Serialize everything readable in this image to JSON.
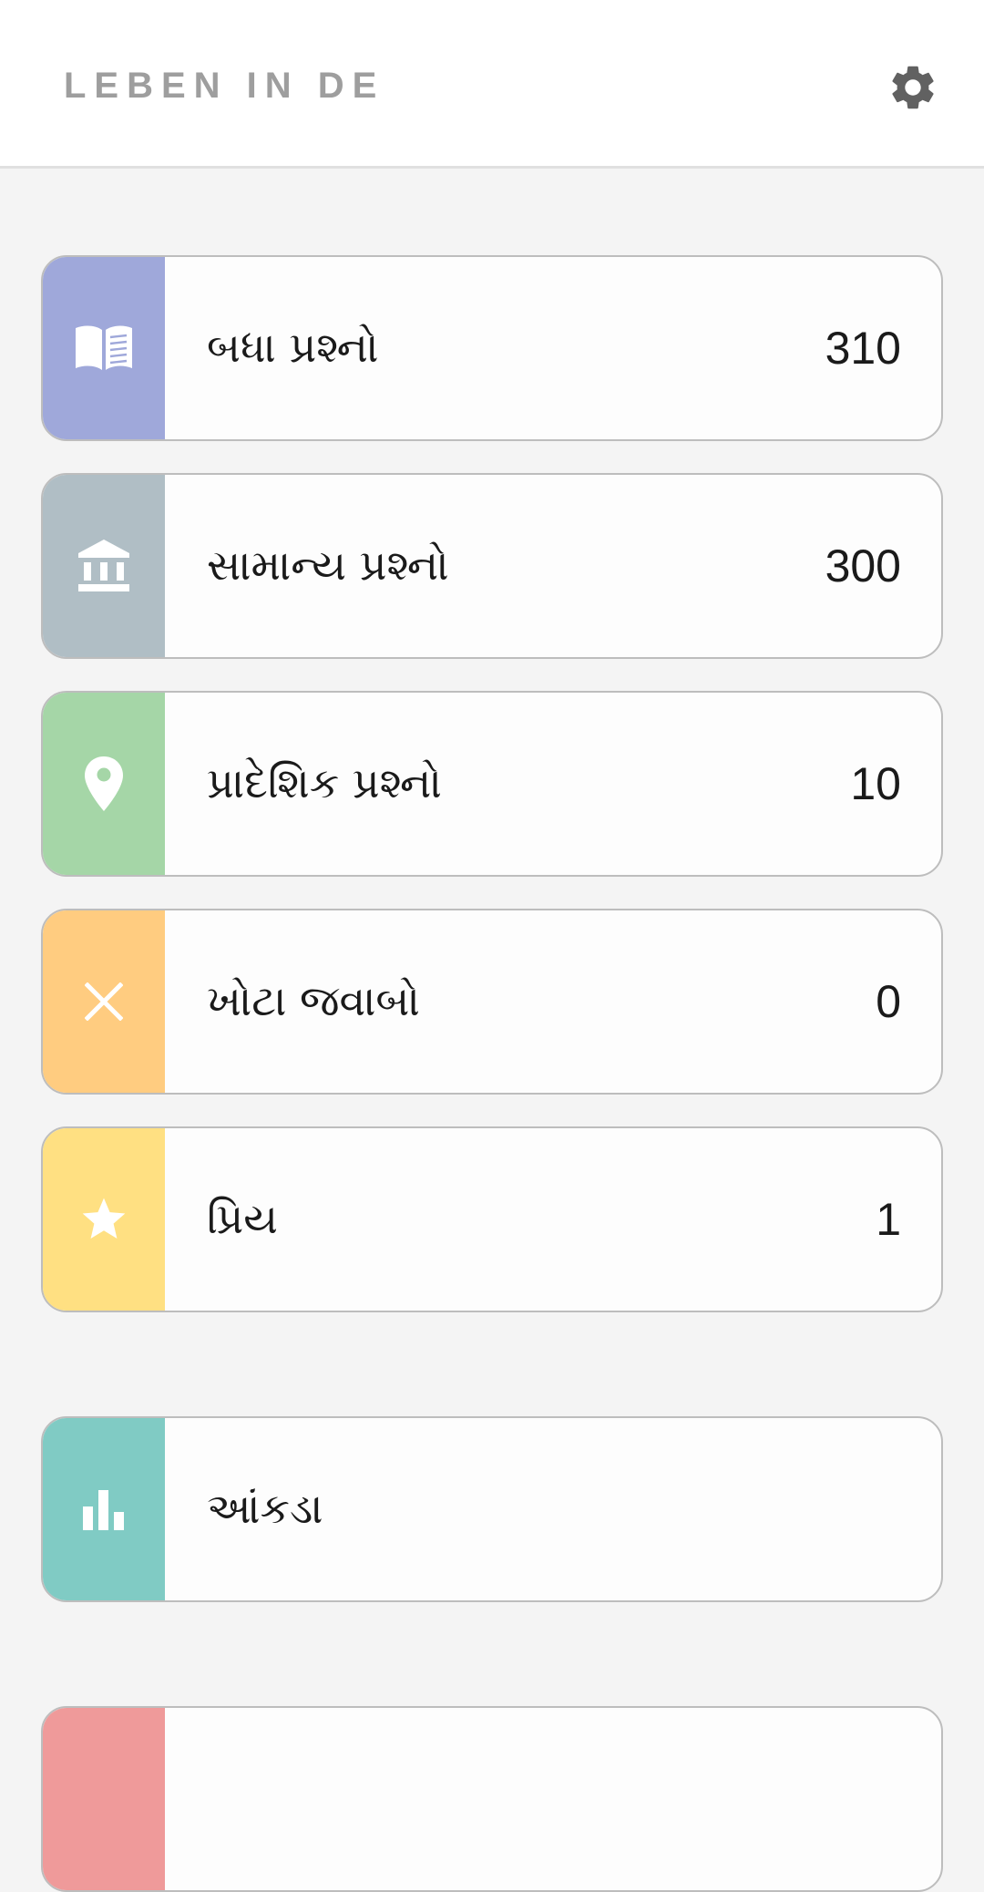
{
  "header": {
    "title": "LEBEN IN DE",
    "settings_icon": "gear-icon"
  },
  "menu": [
    {
      "name": "all-questions",
      "label": "બધા પ્રશ્નો",
      "count": "310",
      "color": "#9fa8da",
      "icon": "book-icon"
    },
    {
      "name": "general-questions",
      "label": "સામાન્ય પ્રશ્નો",
      "count": "300",
      "color": "#b0bec5",
      "icon": "institution-icon"
    },
    {
      "name": "regional-questions",
      "label": "પ્રાદેશિક પ્રશ્નો",
      "count": "10",
      "color": "#a5d6a7",
      "icon": "location-pin-icon"
    },
    {
      "name": "wrong-answers",
      "label": "ખોટા જવાબો",
      "count": "0",
      "color": "#ffcc80",
      "icon": "close-icon"
    },
    {
      "name": "favorites",
      "label": "પ્રિય",
      "count": "1",
      "color": "#ffe082",
      "icon": "star-icon"
    }
  ],
  "statistics": {
    "label": "આંકડા",
    "color": "#80cbc4",
    "icon": "bar-chart-icon"
  },
  "partial_card": {
    "color": "#ef9a9a"
  },
  "colors": {
    "header_bg": "#ffffff",
    "page_bg": "#f4f4f4",
    "title_gray": "#9e9e9e",
    "icon_gray": "#616161"
  }
}
